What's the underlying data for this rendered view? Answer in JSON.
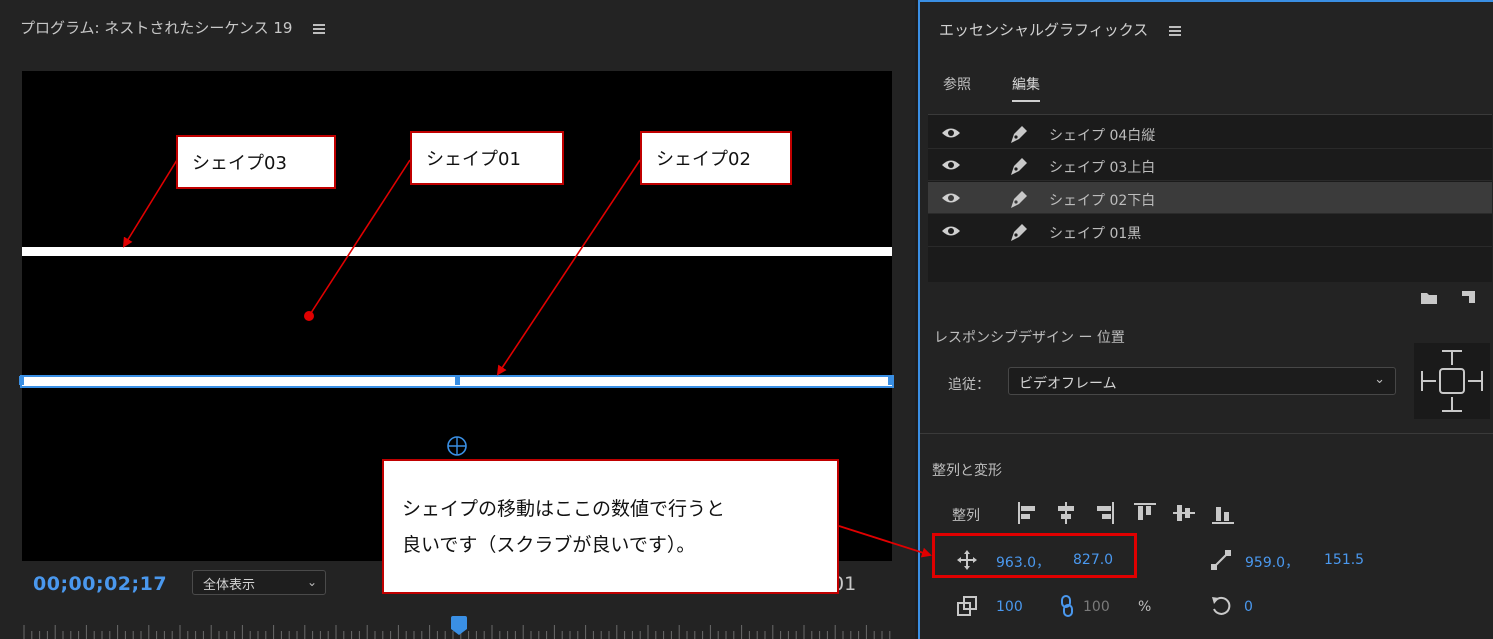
{
  "program": {
    "title": "プログラム: ネストされたシーケンス 19",
    "timecode": "00;00;02;17",
    "zoom_value": "全体表示",
    "end_time_fragment": "01"
  },
  "callouts": {
    "shape03": "シェイプ03",
    "shape01": "シェイプ01",
    "shape02": "シェイプ02",
    "tip_line1": "シェイプの移動はここの数値で行うと",
    "tip_line2": "良いです（スクラブが良いです）。"
  },
  "essential_graphics": {
    "title": "エッセンシャルグラフィックス",
    "tabs": {
      "browse": "参照",
      "edit": "編集"
    },
    "layers": [
      {
        "name": "シェイプ 04白縦",
        "selected": false
      },
      {
        "name": "シェイプ 03上白",
        "selected": false
      },
      {
        "name": "シェイプ 02下白",
        "selected": true
      },
      {
        "name": "シェイプ 01黒",
        "selected": false
      }
    ],
    "responsive_title": "レスポンシブデザイン ー 位置",
    "follow_label": "追従：",
    "follow_value": "ビデオフレーム",
    "align_transform_title": "整列と変形",
    "align_label": "整列",
    "position_x": "963.0，",
    "position_y": "827.0",
    "anchor_x": "959.0，",
    "anchor_y": "151.5",
    "scale": "100",
    "scale_linked": "100",
    "scale_unit": "%",
    "rotation": "0"
  },
  "colors": {
    "accent": "#3a8fe4",
    "callout_border": "#c00000",
    "highlight": "#e00000"
  }
}
